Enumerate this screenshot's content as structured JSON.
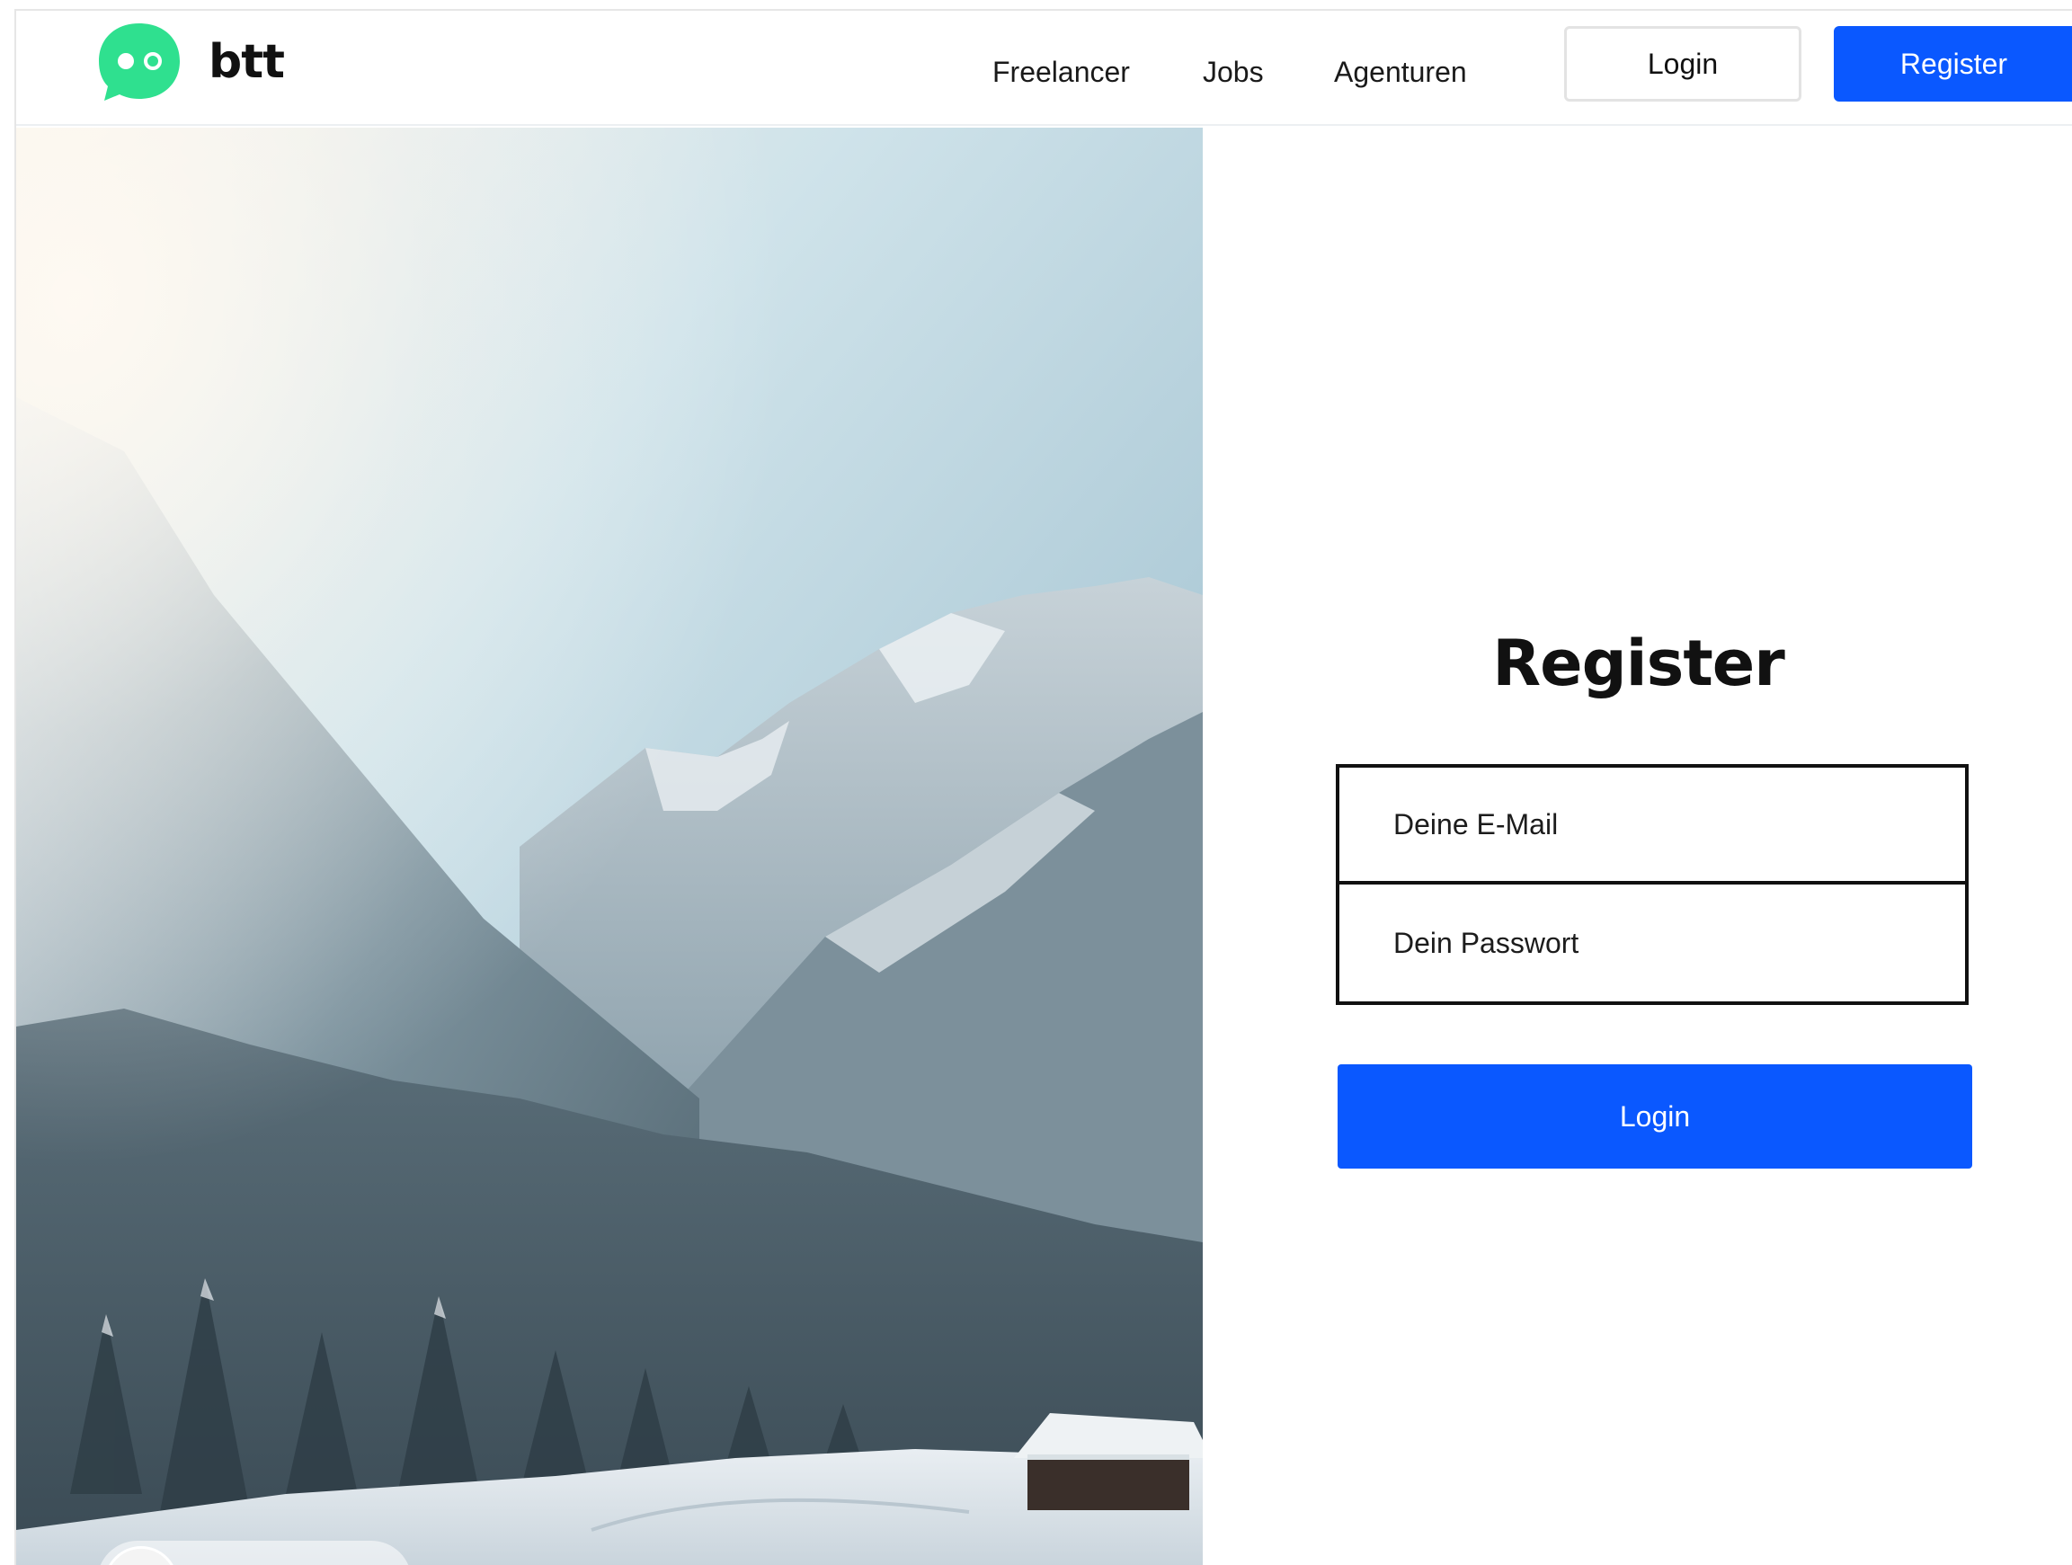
{
  "brand": {
    "name": "btt",
    "accent": "#2fe08f"
  },
  "nav": {
    "links": [
      "Freelancer",
      "Jobs",
      "Agenturen"
    ],
    "login_label": "Login",
    "register_label": "Register"
  },
  "hero": {
    "image": "snowy-mountain-valley-with-cabin"
  },
  "form": {
    "title": "Register",
    "email_placeholder": "Deine E-Mail",
    "password_placeholder": "Dein Passwort",
    "submit_label": "Login"
  },
  "colors": {
    "primary": "#0a58ff",
    "border": "#111111"
  }
}
